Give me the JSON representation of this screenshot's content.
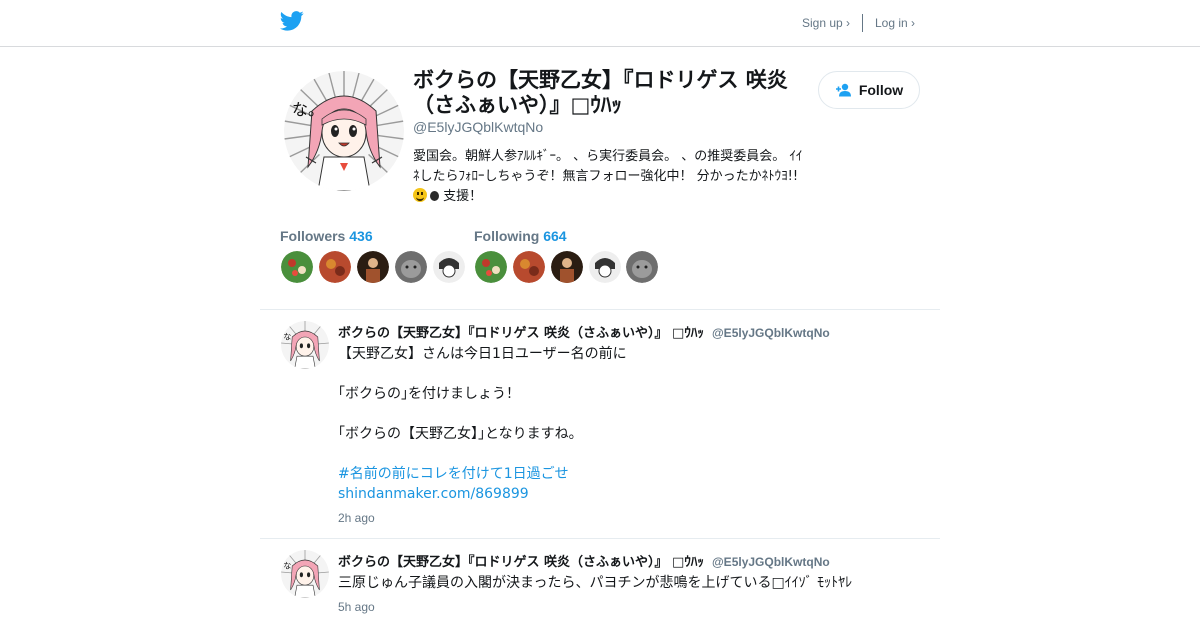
{
  "header": {
    "sign_up_label": "Sign up ›",
    "log_in_label": "Log in ›",
    "brand_color": "#1da1f2"
  },
  "profile": {
    "name": "ボクらの【天野乙女】『ロドリゲス 咲炎（さふぁいや）』□ｳﾊｯ",
    "handle": "@E5lyJGQblKwtqNo",
    "bio_line1": "愛国会。朝鮮人参ｱﾙﾙｷﾞｰ。 、ら実行委員会。 、の推奨委員会。 ｲｲ",
    "bio_line2": "ﾈしたらﾌｫﾛｰしちゃうぞ！無言フォロー強化中！ 分かったかﾈﾄｳﾖ!!",
    "bio_line3": "支援！",
    "bio_emojis": [
      "smiley-emoji",
      "ball-emoji"
    ],
    "follow_label": "Follow",
    "followers_label": "Followers",
    "followers_count": "436",
    "following_label": "Following",
    "following_count": "664",
    "link_color": "#1b95e0"
  },
  "tweets": [
    {
      "name": "ボクらの【天野乙女】『ロドリゲス 咲炎（さふぁいや）』 □ｳﾊｯ",
      "handle": "@E5lyJGQblKwtqNo",
      "line1": "【天野乙女】さんは今日1日ユーザー名の前に",
      "line2": "｢ボクらの｣を付けましょう！",
      "line3": "｢ボクらの【天野乙女】｣となりますね。",
      "hashtag": "#名前の前にコレを付けて1日過ごせ",
      "link": "shindanmaker.com/869899",
      "time": "2h ago"
    },
    {
      "name": "ボクらの【天野乙女】『ロドリゲス 咲炎（さふぁいや）』 □ｳﾊｯ",
      "handle": "@E5lyJGQblKwtqNo",
      "line1": "三原じゅん子議員の入閣が決まったら、パヨチンが悲鳴を上げている□ｲｲｿﾞ ﾓｯﾄﾔﾚ",
      "time": "5h ago"
    }
  ]
}
